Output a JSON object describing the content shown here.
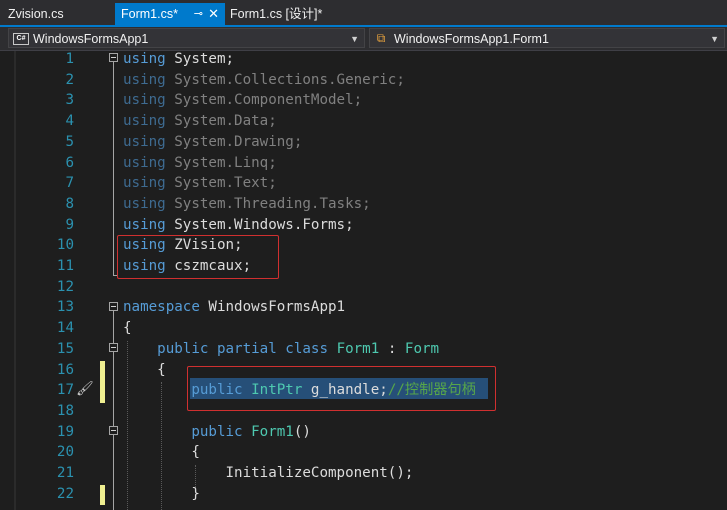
{
  "tabs": [
    {
      "label": "Zvision.cs"
    },
    {
      "label": "Form1.cs*",
      "pin": "⊸",
      "close": "✕"
    },
    {
      "label": "Form1.cs [设计]*"
    }
  ],
  "nav": {
    "project": "WindowsFormsApp1",
    "project_icon": "C#",
    "class": "WindowsFormsApp1.Form1"
  },
  "editor": {
    "lines": [
      {
        "n": "1",
        "tokens": [
          [
            "kw",
            "using"
          ],
          [
            "t",
            " System;"
          ]
        ]
      },
      {
        "n": "2",
        "tokens": [
          [
            "kw",
            "using"
          ],
          [
            "tx",
            " System.Collections.Generic;"
          ]
        ]
      },
      {
        "n": "3",
        "tokens": [
          [
            "kw",
            "using"
          ],
          [
            "tx",
            " System.ComponentModel;"
          ]
        ]
      },
      {
        "n": "4",
        "tokens": [
          [
            "kw",
            "using"
          ],
          [
            "tx",
            " System.Data;"
          ]
        ]
      },
      {
        "n": "5",
        "tokens": [
          [
            "kw",
            "using"
          ],
          [
            "tx",
            " System.Drawing;"
          ]
        ]
      },
      {
        "n": "6",
        "tokens": [
          [
            "kw",
            "using"
          ],
          [
            "tx",
            " System.Linq;"
          ]
        ]
      },
      {
        "n": "7",
        "tokens": [
          [
            "kw",
            "using"
          ],
          [
            "tx",
            " System.Text;"
          ]
        ]
      },
      {
        "n": "8",
        "tokens": [
          [
            "kw",
            "using"
          ],
          [
            "tx",
            " System.Threading.Tasks;"
          ]
        ]
      },
      {
        "n": "9",
        "tokens": [
          [
            "kw",
            "using"
          ],
          [
            "t",
            " System.Windows.Forms;"
          ]
        ]
      },
      {
        "n": "10",
        "tokens": [
          [
            "kw",
            "using"
          ],
          [
            "t",
            " ZVision;"
          ]
        ]
      },
      {
        "n": "11",
        "tokens": [
          [
            "kw",
            "using"
          ],
          [
            "t",
            " cszmcaux;"
          ]
        ]
      },
      {
        "n": "12",
        "tokens": []
      },
      {
        "n": "13",
        "tokens": [
          [
            "kw",
            "namespace"
          ],
          [
            "t",
            " WindowsFormsApp1"
          ]
        ]
      },
      {
        "n": "14",
        "tokens": [
          [
            "t",
            "{"
          ]
        ]
      },
      {
        "n": "15",
        "tokens": [
          [
            "t",
            "    "
          ],
          [
            "kw",
            "public partial class"
          ],
          [
            "t",
            " "
          ],
          [
            "ty",
            "Form1"
          ],
          [
            "t",
            " : "
          ],
          [
            "ty",
            "Form"
          ]
        ]
      },
      {
        "n": "16",
        "tokens": [
          [
            "t",
            "    {"
          ]
        ]
      },
      {
        "n": "17",
        "tokens": [
          [
            "t",
            "        "
          ],
          [
            "kw",
            "public"
          ],
          [
            "t",
            " "
          ],
          [
            "ty",
            "IntPtr"
          ],
          [
            "t",
            " g_handle;"
          ],
          [
            "cm",
            "//控制器句柄"
          ]
        ]
      },
      {
        "n": "18",
        "tokens": []
      },
      {
        "n": "19",
        "tokens": [
          [
            "t",
            "        "
          ],
          [
            "kw",
            "public"
          ],
          [
            "t",
            " "
          ],
          [
            "ty",
            "Form1"
          ],
          [
            "t",
            "()"
          ]
        ]
      },
      {
        "n": "20",
        "tokens": [
          [
            "t",
            "        {"
          ]
        ]
      },
      {
        "n": "21",
        "tokens": [
          [
            "t",
            "            InitializeComponent();"
          ]
        ]
      },
      {
        "n": "22",
        "tokens": [
          [
            "t",
            "        }"
          ]
        ]
      }
    ]
  }
}
